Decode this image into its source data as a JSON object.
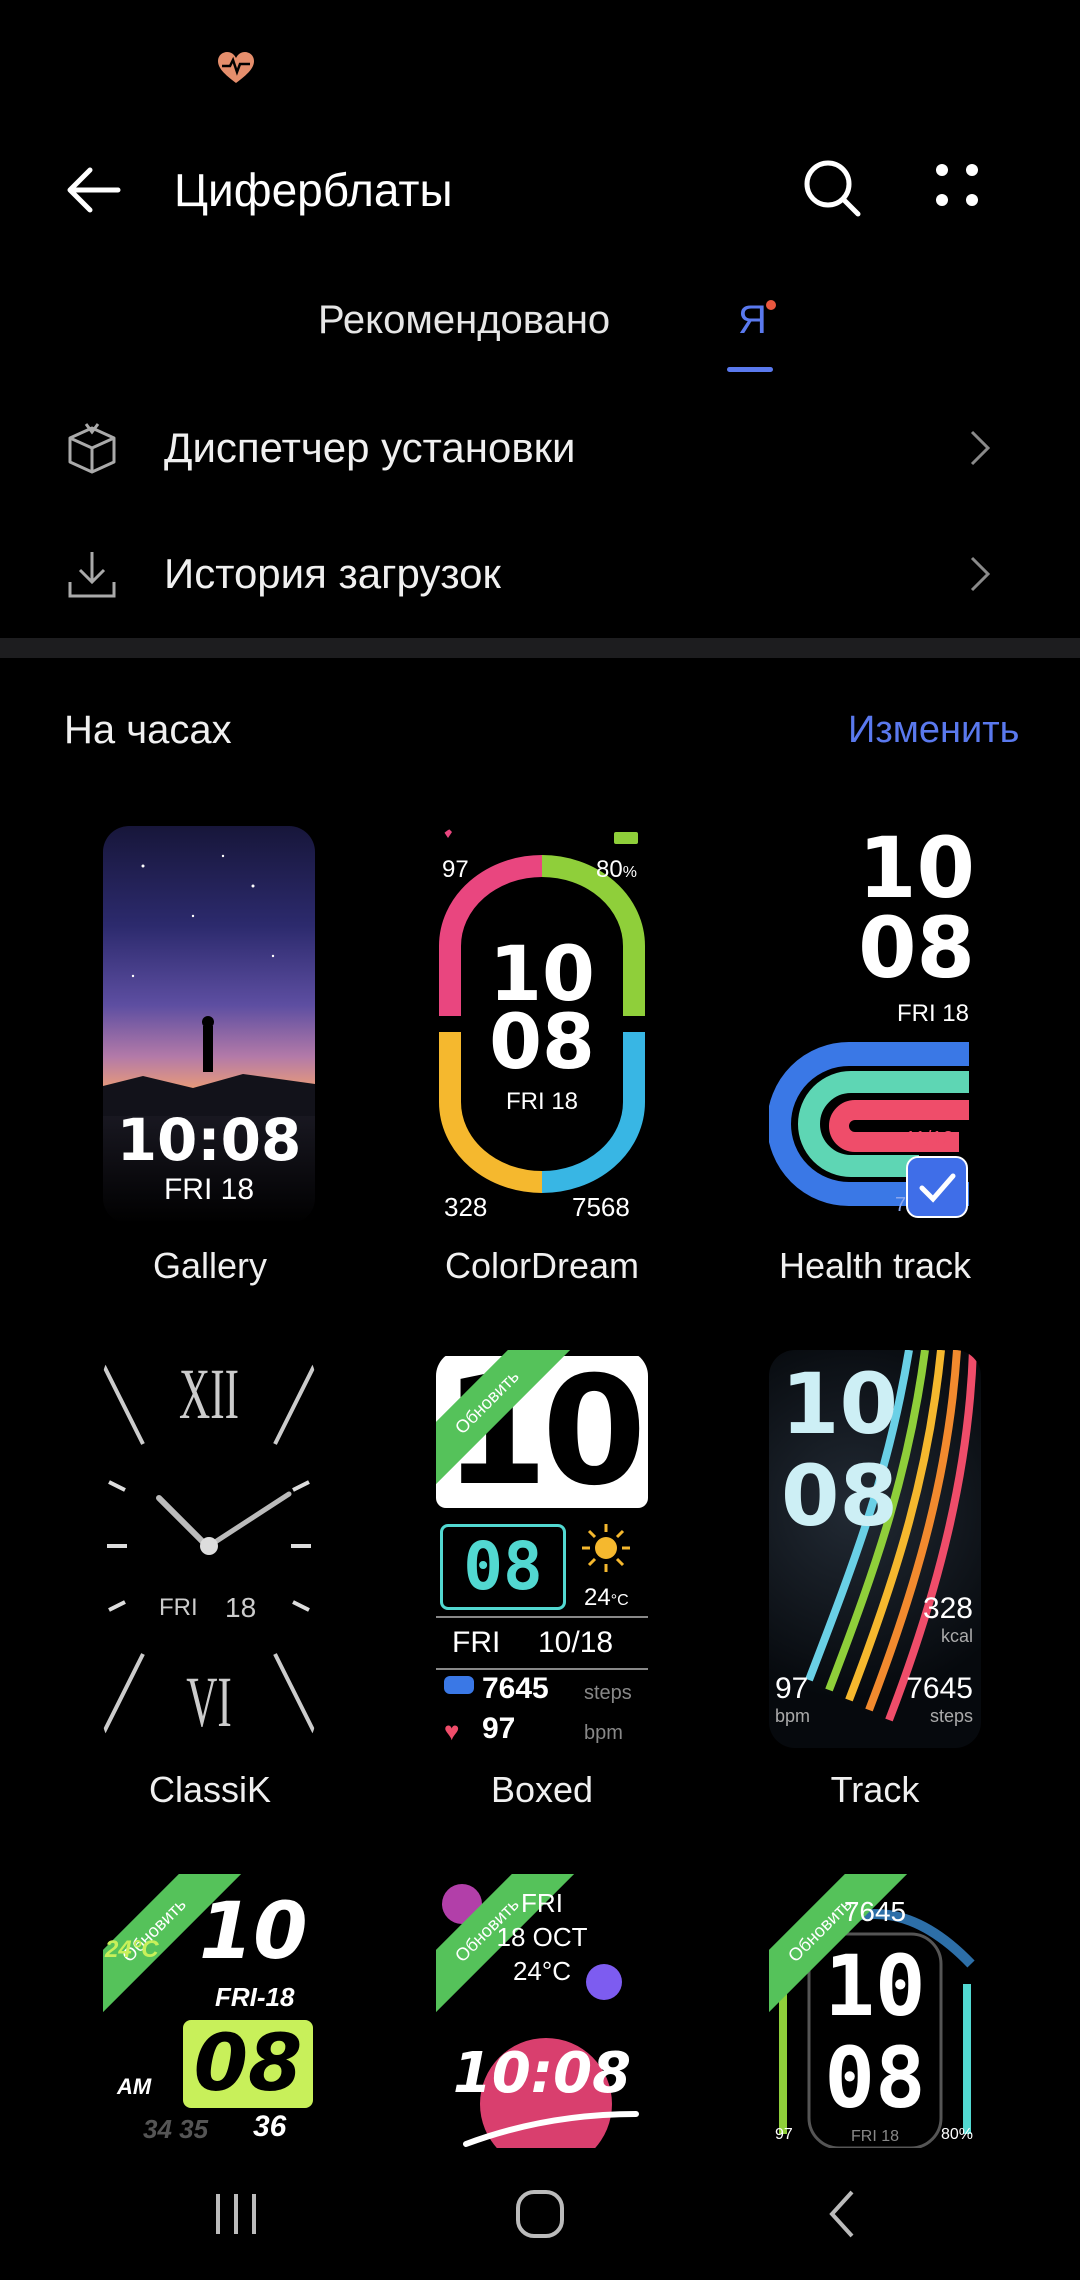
{
  "header": {
    "title": "Циферблаты"
  },
  "tabs": [
    {
      "label": "Рекомендовано",
      "active": false
    },
    {
      "label": "Я",
      "active": true
    }
  ],
  "list": [
    {
      "label": "Диспетчер установки",
      "icon": "package-icon"
    },
    {
      "label": "История загрузок",
      "icon": "download-icon"
    }
  ],
  "section": {
    "title": "На часах",
    "edit": "Изменить"
  },
  "faces": [
    {
      "name": "Gallery",
      "time": "10:08",
      "date": "FRI 18"
    },
    {
      "name": "ColorDream",
      "heart": "97",
      "battery": "80",
      "battery_unit": "%",
      "hour": "10",
      "minute": "08",
      "date": "FRI 18",
      "kcal": "328",
      "steps": "7568"
    },
    {
      "name": "Health track",
      "hour": "10",
      "minute": "08",
      "date": "FRI 18",
      "stat1": "11/12",
      "stat2": "2",
      "stat3": "7645",
      "selected": true
    },
    {
      "name": "ClassiK",
      "top_numeral": "XII",
      "bottom_numeral": "VI",
      "day": "FRI",
      "date": "18"
    },
    {
      "name": "Boxed",
      "hour": "10",
      "minute": "08",
      "temp": "24",
      "temp_unit": "°C",
      "day": "FRI",
      "date": "10/18",
      "steps": "7645",
      "steps_unit": "steps",
      "bpm": "97",
      "bpm_unit": "bpm",
      "ribbon": "Обновить"
    },
    {
      "name": "Track",
      "hour": "10",
      "minute": "08",
      "kcal": "328",
      "kcal_unit": "kcal",
      "bpm": "97",
      "bpm_unit": "bpm",
      "steps": "7645",
      "steps_unit": "steps"
    },
    {
      "ribbon": "Обновить",
      "hour": "10",
      "temp": "24°C",
      "date": "FRI-18",
      "minute": "08",
      "ampm": "AM",
      "seconds": "36",
      "ticks": "34 35"
    },
    {
      "ribbon": "Обновить",
      "day": "FRI",
      "date": "18 OCT",
      "temp": "24°C",
      "time": "10:08"
    },
    {
      "ribbon": "Обновить",
      "steps": "7645",
      "hour": "10",
      "minute": "08",
      "heart": "97",
      "battery": "80",
      "battery_unit": "%",
      "date": "FRI 18"
    }
  ],
  "colors": {
    "accent": "#5a79ee",
    "ribbon": "#55c25a",
    "dot": "#e9573f"
  }
}
